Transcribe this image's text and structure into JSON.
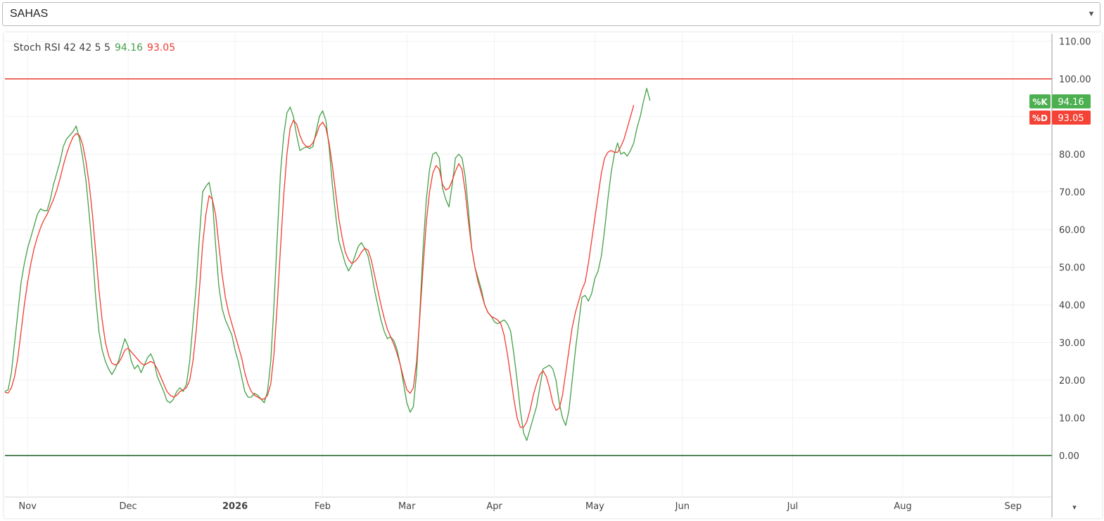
{
  "symbol_select": {
    "value": "SAHAS"
  },
  "legend": {
    "indicator": "Stoch RSI 42 42 5 5",
    "k_value": "94.16",
    "d_value": "93.05"
  },
  "colors": {
    "k": "#43a047",
    "d": "#f23b2f",
    "upper": "#e8372a",
    "lower": "#1b5e20",
    "k_badge": "#4caf50",
    "d_badge": "#f44336"
  },
  "chart_data": {
    "type": "line",
    "y_ticks": [
      "110.00",
      "100.00",
      "90.00",
      "80.00",
      "70.00",
      "60.00",
      "50.00",
      "40.00",
      "30.00",
      "20.00",
      "10.00",
      "0.00"
    ],
    "ylim": [
      -10,
      112
    ],
    "x_ticks": [
      {
        "label": "Nov",
        "bold": false,
        "bar": 7
      },
      {
        "label": "Dec",
        "bold": false,
        "bar": 38
      },
      {
        "label": "2026",
        "bold": true,
        "bar": 71
      },
      {
        "label": "Feb",
        "bold": false,
        "bar": 98
      },
      {
        "label": "Mar",
        "bold": false,
        "bar": 124
      },
      {
        "label": "Apr",
        "bold": false,
        "bar": 151
      },
      {
        "label": "May",
        "bold": false,
        "bar": 182
      },
      {
        "label": "Jun",
        "bold": false,
        "bar": 209
      },
      {
        "label": "Jul",
        "bold": false,
        "bar": 243
      },
      {
        "label": "Aug",
        "bold": false,
        "bar": 277
      },
      {
        "label": "Sep",
        "bold": false,
        "bar": 311
      }
    ],
    "bars_total": 323,
    "upper_band": 100,
    "lower_band": 0,
    "series": [
      {
        "name": "%K",
        "badge": "%K",
        "last": "94.16",
        "values": [
          17.0,
          17.5,
          22.0,
          30.0,
          38.0,
          46.0,
          51.0,
          55.0,
          58.0,
          61.0,
          64.0,
          65.5,
          65.0,
          65.0,
          68.0,
          72.0,
          75.0,
          78.0,
          82.0,
          84.0,
          85.0,
          86.0,
          87.5,
          84.0,
          79.0,
          73.0,
          64.0,
          54.0,
          42.0,
          33.0,
          28.0,
          25.0,
          23.0,
          21.5,
          23.0,
          25.0,
          28.0,
          31.0,
          29.0,
          25.0,
          23.0,
          24.0,
          22.0,
          24.0,
          26.0,
          27.0,
          25.0,
          21.0,
          19.0,
          17.0,
          14.5,
          14.0,
          15.0,
          17.0,
          18.0,
          17.0,
          19.0,
          25.0,
          35.0,
          45.0,
          58.0,
          70.0,
          71.5,
          72.5,
          68.0,
          56.0,
          45.0,
          39.0,
          36.0,
          34.0,
          32.0,
          28.0,
          25.0,
          21.0,
          17.0,
          15.5,
          15.5,
          16.5,
          16.0,
          15.0,
          14.0,
          17.0,
          25.0,
          40.0,
          58.0,
          75.0,
          85.0,
          91.0,
          92.5,
          90.0,
          85.0,
          81.0,
          81.5,
          82.0,
          81.5,
          82.0,
          86.0,
          90.0,
          91.5,
          89.0,
          82.0,
          72.0,
          64.0,
          57.0,
          54.0,
          51.0,
          49.0,
          50.5,
          53.0,
          55.5,
          56.5,
          55.0,
          53.0,
          49.0,
          44.0,
          40.0,
          36.0,
          33.0,
          31.0,
          31.5,
          30.5,
          28.0,
          24.0,
          19.0,
          14.0,
          11.5,
          13.0,
          22.0,
          38.0,
          55.0,
          68.0,
          76.0,
          80.0,
          80.5,
          79.0,
          71.0,
          68.0,
          66.0,
          72.0,
          79.0,
          80.0,
          79.0,
          74.0,
          65.0,
          55.0,
          50.0,
          47.0,
          44.0,
          40.0,
          38.0,
          37.0,
          35.5,
          35.0,
          35.5,
          36.0,
          35.0,
          33.0,
          27.0,
          20.0,
          12.0,
          6.0,
          4.0,
          7.0,
          10.0,
          13.0,
          18.0,
          23.0,
          23.5,
          24.0,
          23.0,
          20.0,
          14.0,
          10.0,
          8.0,
          12.0,
          20.0,
          28.0,
          35.0,
          42.0,
          42.5,
          41.0,
          43.0,
          47.0,
          49.0,
          53.0,
          60.0,
          68.0,
          75.0,
          80.0,
          83.0,
          80.0,
          80.5,
          79.5,
          81.0,
          83.0,
          87.0,
          90.0,
          94.0,
          97.5,
          94.16
        ]
      },
      {
        "name": "%D",
        "badge": "%D",
        "last": "93.05",
        "values": [
          16.8,
          16.6,
          18.0,
          21.0,
          26.0,
          33.0,
          40.0,
          46.0,
          51.0,
          55.0,
          58.0,
          60.5,
          62.5,
          64.0,
          66.0,
          68.0,
          70.5,
          73.5,
          77.0,
          80.0,
          82.5,
          84.5,
          85.5,
          85.0,
          82.5,
          78.0,
          72.0,
          64.0,
          54.0,
          44.0,
          36.0,
          30.0,
          26.5,
          24.5,
          24.0,
          24.5,
          26.0,
          28.0,
          28.5,
          27.5,
          26.5,
          25.5,
          24.5,
          24.0,
          24.5,
          25.0,
          24.5,
          23.0,
          21.0,
          19.0,
          17.0,
          16.0,
          15.5,
          16.0,
          17.0,
          17.5,
          18.0,
          20.0,
          25.0,
          33.0,
          44.0,
          56.0,
          64.0,
          69.0,
          68.0,
          64.0,
          56.0,
          48.0,
          42.0,
          38.0,
          35.0,
          32.0,
          29.0,
          26.0,
          22.0,
          19.0,
          17.0,
          16.0,
          15.5,
          15.0,
          15.0,
          16.0,
          19.0,
          27.0,
          40.0,
          55.0,
          69.0,
          80.0,
          87.0,
          89.0,
          88.0,
          85.0,
          83.0,
          82.0,
          82.0,
          83.0,
          85.0,
          87.5,
          88.5,
          87.0,
          83.0,
          77.0,
          70.0,
          63.0,
          58.0,
          54.0,
          52.0,
          51.0,
          51.5,
          52.5,
          54.0,
          55.0,
          54.5,
          52.0,
          48.0,
          44.0,
          40.0,
          36.5,
          33.5,
          31.5,
          29.5,
          27.0,
          24.0,
          20.5,
          17.5,
          16.5,
          18.0,
          25.0,
          37.0,
          50.0,
          62.0,
          70.0,
          75.0,
          77.0,
          76.0,
          72.0,
          70.5,
          71.0,
          73.0,
          75.5,
          77.5,
          76.0,
          70.0,
          62.0,
          55.0,
          50.0,
          46.0,
          43.0,
          40.0,
          38.0,
          37.0,
          36.5,
          36.0,
          35.0,
          32.0,
          27.0,
          21.0,
          15.0,
          10.0,
          7.5,
          7.5,
          9.0,
          12.0,
          16.0,
          19.0,
          21.5,
          22.5,
          21.0,
          18.0,
          14.0,
          12.0,
          12.5,
          16.0,
          22.0,
          28.0,
          34.0,
          38.0,
          41.0,
          44.0,
          46.0,
          51.0,
          57.0,
          63.0,
          69.0,
          75.0,
          79.0,
          80.5,
          81.0,
          80.5,
          80.5,
          82.0,
          84.0,
          87.0,
          90.0,
          93.05
        ]
      }
    ]
  }
}
